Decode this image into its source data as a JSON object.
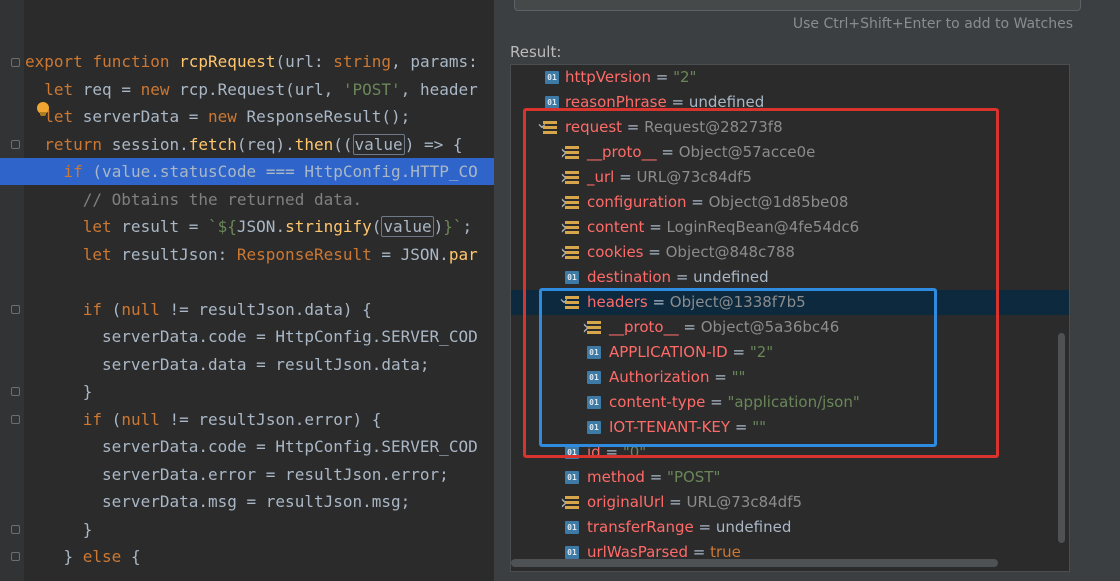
{
  "editor": {
    "lines": [
      {
        "indent": "",
        "segs": [
          [
            "kw",
            "export "
          ],
          [
            "kw",
            "function "
          ],
          [
            "fn",
            "rcpRequest"
          ],
          [
            "",
            "(url: "
          ],
          [
            "ty",
            "string"
          ],
          [
            "",
            ", params:"
          ]
        ]
      },
      {
        "indent": "  ",
        "segs": [
          [
            "kw",
            "let "
          ],
          [
            "",
            "req = "
          ],
          [
            "kw",
            "new "
          ],
          [
            "",
            "rcp."
          ],
          [
            "cls",
            "Request"
          ],
          [
            "",
            "(url, "
          ],
          [
            "str",
            "'POST'"
          ],
          [
            "",
            ", header"
          ]
        ]
      },
      {
        "indent": "  ",
        "segs": [
          [
            "kw",
            "let "
          ],
          [
            "",
            "serverData = "
          ],
          [
            "kw",
            "new "
          ],
          [
            "cls",
            "ResponseResult"
          ],
          [
            "",
            "();"
          ]
        ]
      },
      {
        "indent": "  ",
        "segs": [
          [
            "kw",
            "return "
          ],
          [
            "",
            "session."
          ],
          [
            "fn",
            "fetch"
          ],
          [
            "",
            "(req)."
          ],
          [
            "fn",
            "then"
          ],
          [
            "",
            "(("
          ],
          [
            "boxed",
            "value"
          ],
          [
            "",
            ") => {"
          ]
        ]
      },
      {
        "indent": "    ",
        "segs": [
          [
            "kw",
            "if "
          ],
          [
            "",
            "(value.statusCode === HttpConfig.HTTP_CO"
          ]
        ]
      },
      {
        "indent": "      ",
        "segs": [
          [
            "cm",
            "// Obtains the returned data."
          ]
        ]
      },
      {
        "indent": "      ",
        "segs": [
          [
            "kw",
            "let "
          ],
          [
            "",
            "result = "
          ],
          [
            "str",
            "`${"
          ],
          [
            "",
            "JSON."
          ],
          [
            "fn",
            "stringify"
          ],
          [
            "",
            "("
          ],
          [
            "boxed",
            "value"
          ],
          [
            "",
            ")"
          ],
          [
            "str",
            "}`"
          ],
          [
            "",
            ";"
          ]
        ]
      },
      {
        "indent": "      ",
        "segs": [
          [
            "kw",
            "let "
          ],
          [
            "",
            "resultJson: "
          ],
          [
            "ty",
            "ResponseResult"
          ],
          [
            "",
            " = JSON."
          ],
          [
            "fn",
            "par"
          ]
        ]
      },
      {
        "indent": "",
        "segs": []
      },
      {
        "indent": "      ",
        "segs": [
          [
            "kw",
            "if "
          ],
          [
            "",
            "("
          ],
          [
            "kw",
            "null "
          ],
          [
            "",
            "!= resultJson.data) {"
          ]
        ]
      },
      {
        "indent": "        ",
        "segs": [
          [
            "",
            "serverData.code = HttpConfig.SERVER_COD"
          ]
        ]
      },
      {
        "indent": "        ",
        "segs": [
          [
            "",
            "serverData.data = resultJson.data;"
          ]
        ]
      },
      {
        "indent": "      ",
        "segs": [
          [
            "",
            "}"
          ]
        ]
      },
      {
        "indent": "      ",
        "segs": [
          [
            "kw",
            "if "
          ],
          [
            "",
            "("
          ],
          [
            "kw",
            "null "
          ],
          [
            "",
            "!= resultJson.error) {"
          ]
        ]
      },
      {
        "indent": "        ",
        "segs": [
          [
            "",
            "serverData.code = HttpConfig.SERVER_COD"
          ]
        ]
      },
      {
        "indent": "        ",
        "segs": [
          [
            "",
            "serverData.error = resultJson.error;"
          ]
        ]
      },
      {
        "indent": "        ",
        "segs": [
          [
            "",
            "serverData.msg = resultJson.msg;"
          ]
        ]
      },
      {
        "indent": "      ",
        "segs": [
          [
            "",
            "}"
          ]
        ]
      },
      {
        "indent": "    ",
        "segs": [
          [
            "",
            "} "
          ],
          [
            "kw",
            "else "
          ],
          [
            "",
            "{"
          ]
        ]
      }
    ]
  },
  "debugger": {
    "hint": "Use Ctrl+Shift+Enter to add to Watches",
    "result_label": "Result:",
    "rows": [
      {
        "level": 0,
        "icon": "field",
        "expand": "none",
        "name": "httpVersion",
        "value": "\"2\"",
        "vtype": "str"
      },
      {
        "level": 0,
        "icon": "field",
        "expand": "none",
        "name": "reasonPhrase",
        "value": "undefined",
        "vtype": "plain"
      },
      {
        "level": 0,
        "icon": "object",
        "expand": "open",
        "name": "request",
        "value": "Request@28273f8",
        "vtype": "obj"
      },
      {
        "level": 1,
        "icon": "object",
        "expand": "closed",
        "name": "__proto__",
        "value": "Object@57acce0e",
        "vtype": "obj"
      },
      {
        "level": 1,
        "icon": "object",
        "expand": "closed",
        "name": "_url",
        "value": "URL@73c84df5",
        "vtype": "obj"
      },
      {
        "level": 1,
        "icon": "object",
        "expand": "closed",
        "name": "configuration",
        "value": "Object@1d85be08",
        "vtype": "obj"
      },
      {
        "level": 1,
        "icon": "object",
        "expand": "closed",
        "name": "content",
        "value": "LoginReqBean@4fe54dc6",
        "vtype": "obj"
      },
      {
        "level": 1,
        "icon": "object",
        "expand": "closed",
        "name": "cookies",
        "value": "Object@848c788",
        "vtype": "obj"
      },
      {
        "level": 1,
        "icon": "field",
        "expand": "none",
        "name": "destination",
        "value": "undefined",
        "vtype": "plain"
      },
      {
        "level": 1,
        "icon": "object",
        "expand": "open",
        "name": "headers",
        "value": "Object@1338f7b5",
        "vtype": "obj",
        "selected": true
      },
      {
        "level": 2,
        "icon": "object",
        "expand": "closed",
        "name": "__proto__",
        "value": "Object@5a36bc46",
        "vtype": "obj"
      },
      {
        "level": 2,
        "icon": "field",
        "expand": "none",
        "name": "APPLICATION-ID",
        "value": "\"2\"",
        "vtype": "str"
      },
      {
        "level": 2,
        "icon": "field",
        "expand": "none",
        "name": "Authorization",
        "value": "\"\"",
        "vtype": "str"
      },
      {
        "level": 2,
        "icon": "field",
        "expand": "none",
        "name": "content-type",
        "value": "\"application/json\"",
        "vtype": "str"
      },
      {
        "level": 2,
        "icon": "field",
        "expand": "none",
        "name": "IOT-TENANT-KEY",
        "value": "\"\"",
        "vtype": "str"
      },
      {
        "level": 1,
        "icon": "field",
        "expand": "none",
        "name": "id",
        "value": "\"0\"",
        "vtype": "str"
      },
      {
        "level": 1,
        "icon": "field",
        "expand": "none",
        "name": "method",
        "value": "\"POST\"",
        "vtype": "str"
      },
      {
        "level": 1,
        "icon": "object",
        "expand": "closed",
        "name": "originalUrl",
        "value": "URL@73c84df5",
        "vtype": "obj"
      },
      {
        "level": 1,
        "icon": "field",
        "expand": "none",
        "name": "transferRange",
        "value": "undefined",
        "vtype": "plain"
      },
      {
        "level": 1,
        "icon": "field",
        "expand": "none",
        "name": "urlWasParsed",
        "value": "true",
        "vtype": "kw"
      }
    ]
  }
}
